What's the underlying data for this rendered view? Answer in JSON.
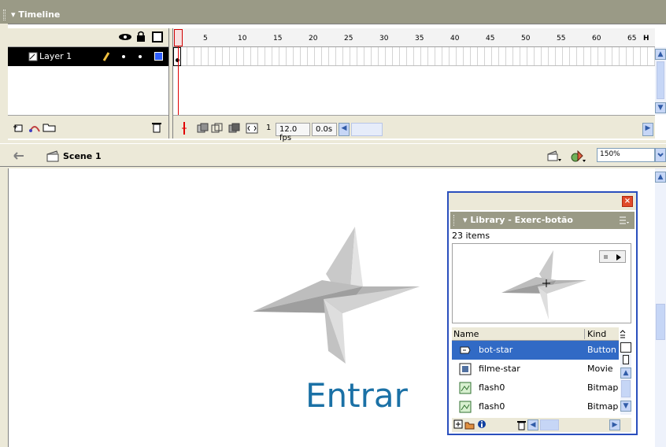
{
  "timeline": {
    "title": "Timeline",
    "ruler_ticks": [
      "1",
      "5",
      "10",
      "15",
      "20",
      "25",
      "30",
      "35",
      "40",
      "45",
      "50",
      "55",
      "60",
      "65"
    ],
    "ruler_overflow": "H",
    "layer_name": "Layer 1",
    "current_frame": "1",
    "frame_rate": "12.0 fps",
    "elapsed_time": "0.0s"
  },
  "scene": {
    "label": "Scene 1",
    "zoom": "150%"
  },
  "stage": {
    "button_text": "Entrar",
    "shape_colors": {
      "light": "#d9d9d9",
      "mid": "#bdbdbd",
      "dark": "#999999"
    },
    "text_color": "#1b71a6"
  },
  "library": {
    "title": "Library - Exerc-botão",
    "item_count": "23 items",
    "columns": [
      "Name",
      "Kind"
    ],
    "items": [
      {
        "name": "bot-star",
        "kind": "Button",
        "icon": "button-symbol-icon"
      },
      {
        "name": "filme-star",
        "kind": "Movie",
        "icon": "movieclip-symbol-icon"
      },
      {
        "name": "flash0",
        "kind": "Bitmap",
        "icon": "bitmap-icon"
      },
      {
        "name": "flash0",
        "kind": "Bitmap",
        "icon": "bitmap-icon"
      }
    ]
  }
}
